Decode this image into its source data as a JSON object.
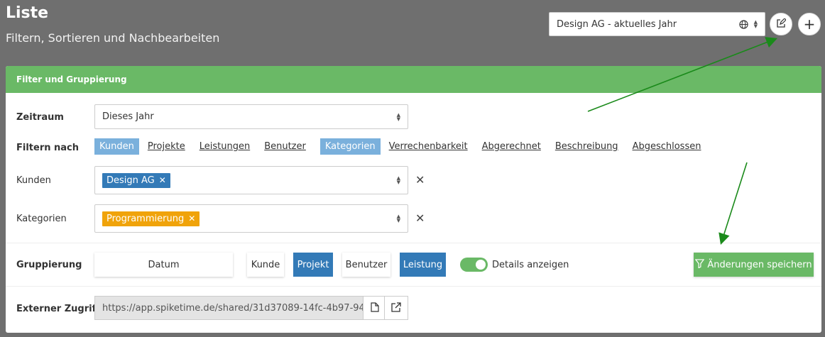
{
  "header": {
    "title": "Liste",
    "subtitle": "Filtern, Sortieren und Nachbearbeiten",
    "preset": "Design AG - aktuelles Jahr",
    "add_label": "+"
  },
  "card": {
    "title": "Filter und Gruppierung"
  },
  "zeitraum": {
    "label": "Zeitraum",
    "value": "Dieses Jahr"
  },
  "filter": {
    "label": "Filtern nach",
    "options": [
      "Kunden",
      "Projekte",
      "Leistungen",
      "Benutzer",
      "Kategorien",
      "Verrechenbarkeit",
      "Abgerechnet",
      "Beschreibung",
      "Abgeschlossen"
    ],
    "active": [
      "Kunden",
      "Kategorien"
    ]
  },
  "kunden": {
    "label": "Kunden",
    "tag": "Design AG"
  },
  "kategorien": {
    "label": "Kategorien",
    "tag": "Programmierung"
  },
  "gruppierung": {
    "label": "Gruppierung",
    "buttons": [
      "Datum",
      "Kunde",
      "Projekt",
      "Benutzer",
      "Leistung"
    ],
    "active": [
      "Projekt",
      "Leistung"
    ],
    "details_label": "Details anzeigen",
    "details_on": true,
    "save_label": "Änderungen speichern"
  },
  "extern": {
    "label": "Externer Zugriff",
    "url": "https://app.spiketime.de/shared/31d37089-14fc-4b97-94"
  },
  "colors": {
    "accent_green": "#6ab966",
    "active_blue": "#337ab7",
    "tag_orange": "#f0a30a",
    "filter_active": "#7ab0dc"
  }
}
